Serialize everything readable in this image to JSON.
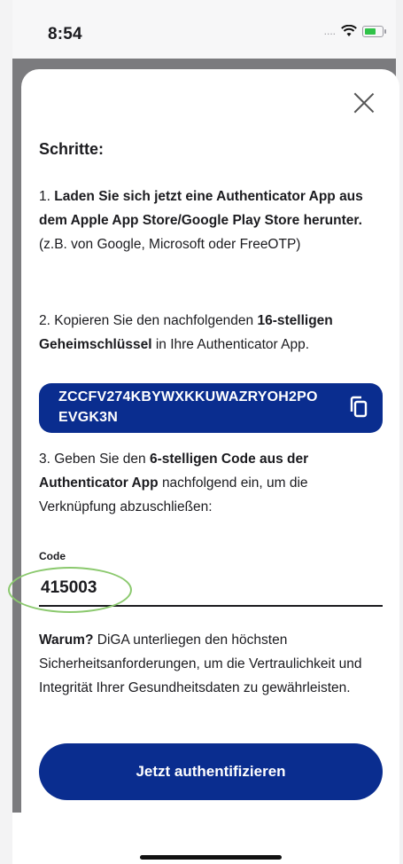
{
  "status": {
    "time": "8:54",
    "signal_text": "....",
    "icons": [
      "signal-icon",
      "wifi-icon",
      "battery-charging-icon"
    ]
  },
  "sheet": {
    "title": "Schritte:",
    "step1": {
      "prefix": "1.",
      "bold": "Laden Sie sich jetzt eine Authenticator App aus dem Apple App Store/Google Play Store herunter.",
      "normal": "(z.B. von Google, Microsoft oder FreeOTP)"
    },
    "step2": {
      "prefix": "2. Kopieren Sie den nachfolgenden",
      "bold": "16-stelligen Geheimschlüssel",
      "suffix": "in Ihre Authenticator App."
    },
    "secret_key": "ZCCFV274KBYWXKKUWAZRYOH2POEVGK3N",
    "step3": {
      "prefix": "3. Geben Sie den",
      "bold": "6-stelligen Code aus der Authenticator App",
      "suffix": "nachfolgend ein, um die Verknüpfung abzuschließen:"
    },
    "code_field": {
      "label": "Code",
      "value": "415003"
    },
    "why": {
      "bold": "Warum?",
      "text": "DiGA unterliegen den höchsten Sicherheitsanforderungen, um die Vertraulichkeit und Integrität Ihrer Gesundheitsdaten zu gewährleisten."
    },
    "button_label": "Jetzt authentifizieren"
  },
  "colors": {
    "primary": "#0a2d8f",
    "highlight": "#8bc96e",
    "backdrop": "#7b7b7e"
  }
}
